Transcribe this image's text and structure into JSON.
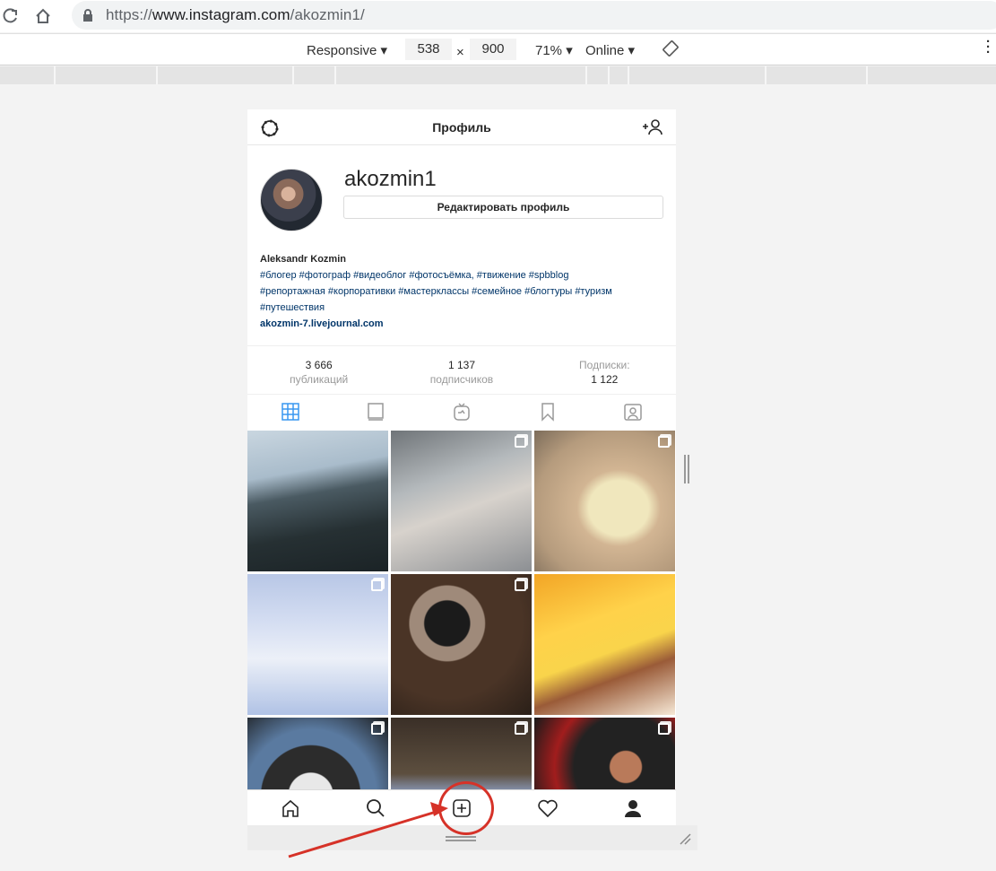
{
  "browser": {
    "url_prefix": "https://",
    "url_host": "www.instagram.com",
    "url_path": "/akozmin1/"
  },
  "device_toolbar": {
    "device": "Responsive",
    "width": "538",
    "times": "×",
    "height": "900",
    "zoom": "71%",
    "network": "Online"
  },
  "header": {
    "title": "Профиль"
  },
  "profile": {
    "username": "akozmin1",
    "edit_button": "Редактировать профиль",
    "full_name": "Aleksandr Kozmin",
    "bio_line1": "#блогер #фотограф #видеоблог #фотосъёмка, #твижение #spbblog",
    "bio_line2": "#репортажная #корпоративки #мастерклассы #семейное #блогтуры #туризм",
    "bio_line3": "#путешествия",
    "link": "akozmin-7.livejournal.com"
  },
  "stats": [
    {
      "num": "3 666",
      "label": "публикаций"
    },
    {
      "num": "1 137",
      "label": "подписчиков"
    },
    {
      "num": "1 122",
      "label": "Подписки:"
    }
  ],
  "tabs": [
    "grid-icon",
    "feed-icon",
    "igtv-icon",
    "bookmark-icon",
    "tagged-icon"
  ],
  "posts": [
    {
      "kind": "sea",
      "multi": false
    },
    {
      "kind": "medical",
      "multi": true
    },
    {
      "kind": "cheese",
      "multi": true
    },
    {
      "kind": "snowman",
      "multi": true
    },
    {
      "kind": "woman",
      "multi": true
    },
    {
      "kind": "chocolate",
      "multi": false
    },
    {
      "kind": "dali",
      "multi": true
    },
    {
      "kind": "exhibition",
      "multi": true
    },
    {
      "kind": "man-reading",
      "multi": true
    }
  ],
  "bottom_nav": [
    "home-icon",
    "search-icon",
    "new-post-icon",
    "activity-icon",
    "profile-icon"
  ],
  "colors": {
    "annotation": "#d63228",
    "link": "#003569",
    "active_tab": "#3897f0"
  }
}
